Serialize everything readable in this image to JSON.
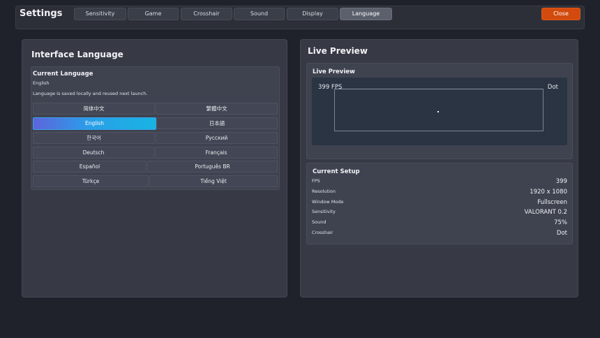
{
  "app": {
    "title": "Settings",
    "close_label": "Close"
  },
  "tabs": [
    {
      "label": "Sensitivity"
    },
    {
      "label": "Game"
    },
    {
      "label": "Crosshair"
    },
    {
      "label": "Sound"
    },
    {
      "label": "Display"
    },
    {
      "label": "Language",
      "active": true
    }
  ],
  "language_panel": {
    "title": "Interface Language",
    "card_title": "Current Language",
    "current": "English",
    "note": "Language is saved locally and reused next launch.",
    "options": [
      {
        "label": "简体中文"
      },
      {
        "label": "繁體中文"
      },
      {
        "label": "English",
        "selected": true
      },
      {
        "label": "日本語"
      },
      {
        "label": "한국어"
      },
      {
        "label": "Русский"
      },
      {
        "label": "Deutsch"
      },
      {
        "label": "Français"
      },
      {
        "label": "Español"
      },
      {
        "label": "Português BR"
      },
      {
        "label": "Türkçe"
      },
      {
        "label": "Tiếng Việt"
      }
    ]
  },
  "preview_panel": {
    "title": "Live Preview",
    "card_title": "Live Preview",
    "fps_text": "399 FPS",
    "crosshair_text": "Dot"
  },
  "setup": {
    "title": "Current Setup",
    "rows": [
      {
        "label": "FPS",
        "value": "399"
      },
      {
        "label": "Resolution",
        "value": "1920 x 1080"
      },
      {
        "label": "Window Mode",
        "value": "Fullscreen"
      },
      {
        "label": "Sensitivity",
        "value": "VALORANT 0.2"
      },
      {
        "label": "Sound",
        "value": "75%"
      },
      {
        "label": "Crosshair",
        "value": "Dot"
      }
    ]
  },
  "colors": {
    "background": "#20222b",
    "panel": "#373a45",
    "accent_close": "#d24a0e",
    "accent_selected_start": "#5e64dd",
    "accent_selected_end": "#17b4e2"
  }
}
